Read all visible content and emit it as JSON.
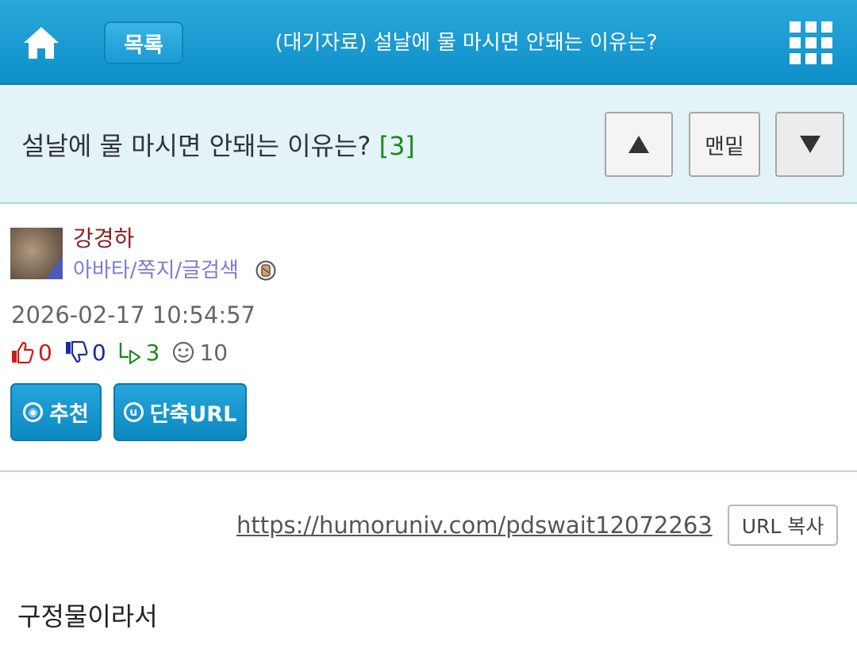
{
  "colors": {
    "header_blue": "#1b9ad3",
    "title_bg": "#e3f3f8",
    "author_name": "#8b1e1e",
    "author_links": "#7b7bd6",
    "reply_count": "#1b8a1b",
    "upvote": "#cc1b1b",
    "downvote": "#1a2a9a"
  },
  "header": {
    "home_icon": "home-icon",
    "list_label": "목록",
    "title": "(대기자료) 설날에 물 마시면 안돼는 이유는?",
    "menu_icon": "grid-menu-icon"
  },
  "post": {
    "title": "설날에 물 마시면 안돼는 이유는?",
    "comment_count": "[3]",
    "nav": {
      "up_icon": "triangle-up-icon",
      "bottom_label": "맨밑",
      "down_icon": "triangle-down-icon"
    },
    "author": {
      "name": "강경하",
      "links": "아바타/쪽지/글검색",
      "badge_icon": "member-badge-icon"
    },
    "datetime": "2026-02-17 10:54:57",
    "stats": {
      "upvotes": "0",
      "downvotes": "0",
      "replies": "3",
      "views": "10"
    },
    "actions": {
      "recommend_label": "추천",
      "shorturl_label": "단축URL"
    },
    "url": "https://humoruniv.com/pdswait12072263",
    "copy_label": "URL 복사",
    "body": "구정물이라서"
  }
}
